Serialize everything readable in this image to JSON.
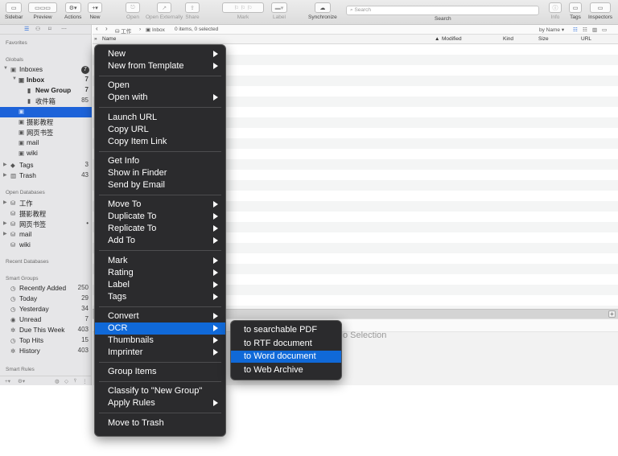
{
  "toolbar": {
    "buttons": [
      {
        "label": "Sidebar",
        "icon": "sidebar-icon",
        "enabled": true
      },
      {
        "label": "Preview",
        "icon": "preview-icon",
        "enabled": true
      },
      {
        "label": "Actions",
        "icon": "gear-icon",
        "enabled": true
      },
      {
        "label": "New",
        "icon": "plus-icon",
        "enabled": true
      },
      {
        "label": "Open",
        "icon": "open-icon",
        "enabled": false
      },
      {
        "label": "Open Externally",
        "icon": "open-externally-icon",
        "enabled": false
      },
      {
        "label": "Share",
        "icon": "share-icon",
        "enabled": false
      },
      {
        "label": "Mark",
        "icon": "flag-icon",
        "enabled": false
      },
      {
        "label": "Label",
        "icon": "label-icon",
        "enabled": false
      },
      {
        "label": "Synchronize",
        "icon": "sync-icon",
        "enabled": true
      },
      {
        "label": "Info",
        "icon": "info-icon",
        "enabled": false
      },
      {
        "label": "Tags",
        "icon": "tags-icon",
        "enabled": true
      },
      {
        "label": "Inspectors",
        "icon": "inspectors-icon",
        "enabled": true
      }
    ],
    "search_placeholder": "Search",
    "search_label": "Search"
  },
  "sidebar": {
    "favorites_header": "Favorites",
    "globals_header": "Globals",
    "globals": [
      {
        "label": "Inboxes",
        "badge": "7",
        "icon": "inbox-icon"
      },
      {
        "label": "Inbox",
        "count": "7",
        "icon": "inbox-icon"
      },
      {
        "label": "New Group",
        "count": "7",
        "icon": "group-icon"
      },
      {
        "label": "收件箱",
        "count": "85",
        "icon": "group-icon"
      },
      {
        "label": "",
        "icon": "database-icon"
      },
      {
        "label": "摄影教程",
        "icon": "database-icon"
      },
      {
        "label": "网页书签",
        "icon": "database-icon"
      },
      {
        "label": "mail",
        "icon": "database-icon"
      },
      {
        "label": "wiki",
        "icon": "database-icon"
      },
      {
        "label": "Tags",
        "count": "3",
        "icon": "tag-icon"
      },
      {
        "label": "Trash",
        "count": "43",
        "icon": "trash-icon"
      }
    ],
    "open_databases_header": "Open Databases",
    "open_databases": [
      {
        "label": "工作"
      },
      {
        "label": "摄影教程"
      },
      {
        "label": "网页书签",
        "badge": "•"
      },
      {
        "label": "mail"
      },
      {
        "label": "wiki"
      }
    ],
    "recent_databases_header": "Recent Databases",
    "smart_groups_header": "Smart Groups",
    "smart_groups": [
      {
        "label": "Recently Added",
        "count": "250"
      },
      {
        "label": "Today",
        "count": "29"
      },
      {
        "label": "Yesterday",
        "count": "34"
      },
      {
        "label": "Unread",
        "count": "7"
      },
      {
        "label": "Due This Week",
        "count": "403"
      },
      {
        "label": "Top Hits",
        "count": "15"
      },
      {
        "label": "History",
        "count": "403"
      }
    ],
    "smart_rules_header": "Smart Rules"
  },
  "nav": {
    "breadcrumb_db": "工作",
    "breadcrumb_group": "Inbox",
    "status": "0 items, 0 selected",
    "sort_by": "by Name"
  },
  "columns": [
    "Name",
    "Modified",
    "Kind",
    "Size",
    "URL"
  ],
  "preview": {
    "no_selection": "No Selection"
  },
  "context_menu": {
    "groups": [
      [
        {
          "label": "New",
          "submenu": true
        },
        {
          "label": "New from Template",
          "submenu": true
        }
      ],
      [
        {
          "label": "Open",
          "submenu": false
        },
        {
          "label": "Open with",
          "submenu": true
        }
      ],
      [
        {
          "label": "Launch URL",
          "submenu": false
        },
        {
          "label": "Copy URL",
          "submenu": false
        },
        {
          "label": "Copy Item Link",
          "submenu": false
        }
      ],
      [
        {
          "label": "Get Info",
          "submenu": false
        },
        {
          "label": "Show in Finder",
          "submenu": false
        },
        {
          "label": "Send by Email",
          "submenu": false
        }
      ],
      [
        {
          "label": "Move To",
          "submenu": true
        },
        {
          "label": "Duplicate To",
          "submenu": true
        },
        {
          "label": "Replicate To",
          "submenu": true
        },
        {
          "label": "Add To",
          "submenu": true
        }
      ],
      [
        {
          "label": "Mark",
          "submenu": true
        },
        {
          "label": "Rating",
          "submenu": true
        },
        {
          "label": "Label",
          "submenu": true
        },
        {
          "label": "Tags",
          "submenu": true
        }
      ],
      [
        {
          "label": "Convert",
          "submenu": true
        },
        {
          "label": "OCR",
          "submenu": true,
          "highlighted": true
        },
        {
          "label": "Thumbnails",
          "submenu": true
        },
        {
          "label": "Imprinter",
          "submenu": true
        }
      ],
      [
        {
          "label": "Group Items",
          "submenu": false
        }
      ],
      [
        {
          "label": "Classify to \"New Group\"",
          "submenu": false
        },
        {
          "label": "Apply Rules",
          "submenu": true
        }
      ],
      [
        {
          "label": "Move to Trash",
          "submenu": false
        }
      ]
    ]
  },
  "ocr_submenu": {
    "items": [
      {
        "label": "to searchable PDF"
      },
      {
        "label": "to RTF document"
      },
      {
        "label": "to Word document",
        "highlighted": true
      },
      {
        "label": "to Web Archive"
      }
    ]
  },
  "colors": {
    "selection": "#1d63d9",
    "menu_bg": "#2b2b2d",
    "menu_highlight": "#1069d8"
  }
}
